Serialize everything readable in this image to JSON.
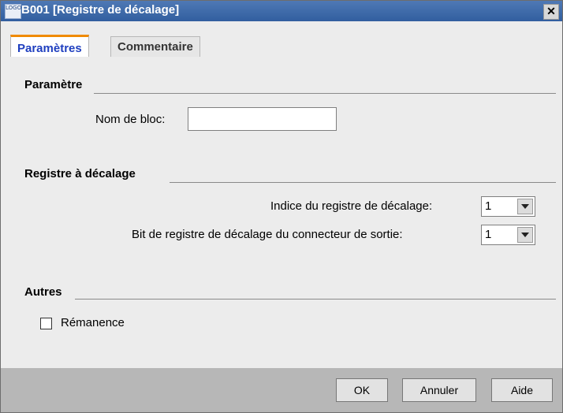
{
  "window": {
    "title": "B001 [Registre de décalage]",
    "icon_text": "LOGO"
  },
  "tabs": [
    {
      "label": "Paramètres",
      "active": true
    },
    {
      "label": "Commentaire",
      "active": false
    }
  ],
  "sections": {
    "parametre": "Paramètre",
    "registre": "Registre à décalage",
    "autres": "Autres"
  },
  "fields": {
    "block_name_label": "Nom de bloc:",
    "block_name_value": "",
    "index_label": "Indice du registre de décalage:",
    "index_value": "1",
    "bit_label": "Bit de registre de décalage du connecteur de sortie:",
    "bit_value": "1",
    "remanence_label": "Rémanence",
    "remanence_checked": false
  },
  "buttons": {
    "ok": "OK",
    "cancel": "Annuler",
    "help": "Aide",
    "close": "✕"
  },
  "colors": {
    "titlebar": "#315e9f",
    "active_tab_text": "#1f3fbf",
    "active_tab_accent": "#f08a00",
    "footer": "#b7b7b7"
  }
}
